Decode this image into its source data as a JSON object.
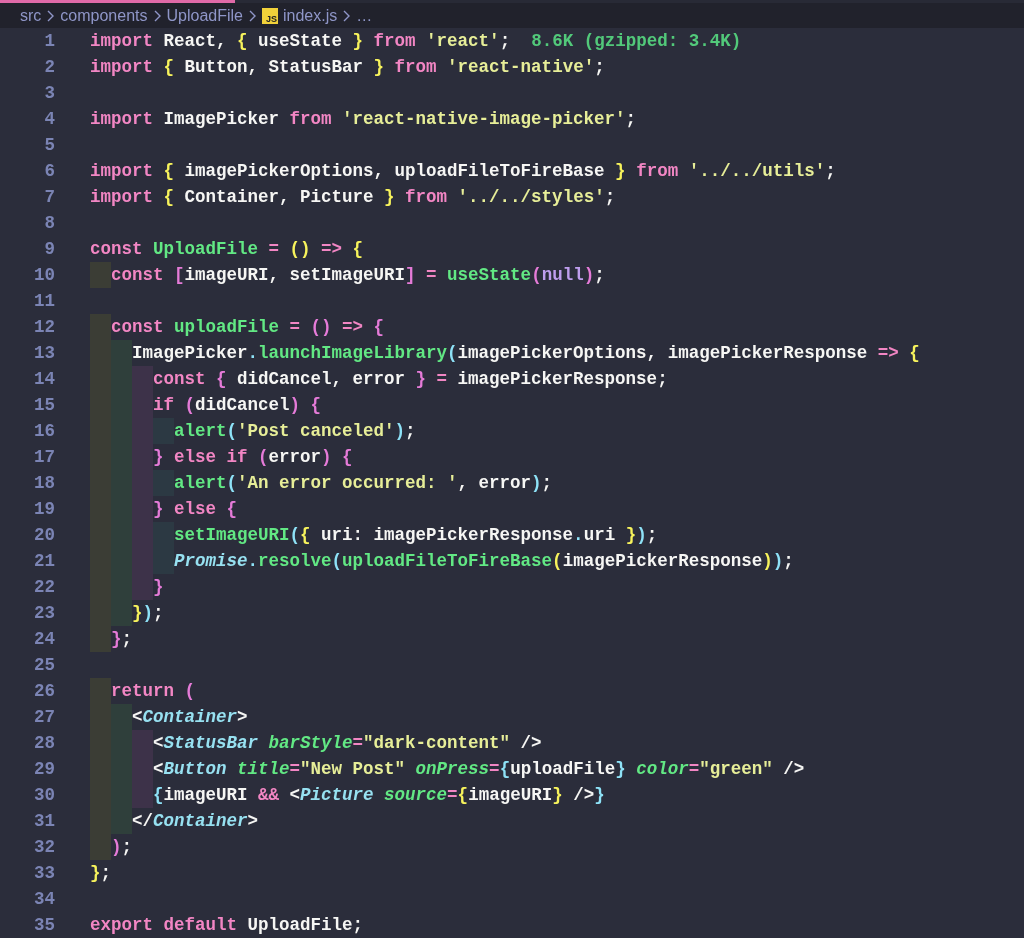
{
  "breadcrumb": [
    {
      "kind": "folder",
      "label": "src"
    },
    {
      "kind": "folder",
      "label": "components"
    },
    {
      "kind": "folder",
      "label": "UploadFile"
    },
    {
      "kind": "file",
      "label": "index.js",
      "badge": "JS"
    },
    {
      "kind": "more",
      "label": "…"
    }
  ],
  "code_lines": [
    {
      "number": "1",
      "tokens": [
        {
          "kind": "keyword",
          "text": "import"
        },
        {
          "kind": "plain",
          "text": " React, "
        },
        {
          "kind": "bracket1",
          "text": "{"
        },
        {
          "kind": "plain",
          "text": " useState "
        },
        {
          "kind": "bracket1",
          "text": "}"
        },
        {
          "kind": "keyword",
          "text": " from "
        },
        {
          "kind": "string",
          "text": "'react'"
        },
        {
          "kind": "plain",
          "text": ";"
        },
        {
          "kind": "cost",
          "text": "  8.6K (gzipped: 3.4K)"
        }
      ]
    },
    {
      "number": "2",
      "tokens": [
        {
          "kind": "keyword",
          "text": "import "
        },
        {
          "kind": "bracket1",
          "text": "{"
        },
        {
          "kind": "plain",
          "text": " Button, StatusBar "
        },
        {
          "kind": "bracket1",
          "text": "}"
        },
        {
          "kind": "keyword",
          "text": " from "
        },
        {
          "kind": "string",
          "text": "'react-native'"
        },
        {
          "kind": "plain",
          "text": ";"
        }
      ]
    },
    {
      "number": "3"
    },
    {
      "number": "4",
      "tokens": [
        {
          "kind": "keyword",
          "text": "import "
        },
        {
          "kind": "plain",
          "text": "ImagePicker "
        },
        {
          "kind": "keyword",
          "text": "from "
        },
        {
          "kind": "string",
          "text": "'react-native-image-picker'"
        },
        {
          "kind": "plain",
          "text": ";"
        }
      ]
    },
    {
      "number": "5"
    },
    {
      "number": "6",
      "tokens": [
        {
          "kind": "keyword",
          "text": "import "
        },
        {
          "kind": "bracket1",
          "text": "{"
        },
        {
          "kind": "plain",
          "text": " imagePickerOptions, uploadFileToFireBase "
        },
        {
          "kind": "bracket1",
          "text": "}"
        },
        {
          "kind": "keyword",
          "text": " from "
        },
        {
          "kind": "string",
          "text": "'../../utils'"
        },
        {
          "kind": "plain",
          "text": ";"
        }
      ]
    },
    {
      "number": "7",
      "tokens": [
        {
          "kind": "keyword",
          "text": "import "
        },
        {
          "kind": "bracket1",
          "text": "{"
        },
        {
          "kind": "plain",
          "text": " Container, Picture "
        },
        {
          "kind": "bracket1",
          "text": "}"
        },
        {
          "kind": "keyword",
          "text": " from "
        },
        {
          "kind": "string",
          "text": "'../../styles'"
        },
        {
          "kind": "plain",
          "text": ";"
        }
      ]
    },
    {
      "number": "8"
    },
    {
      "number": "9",
      "tokens": [
        {
          "kind": "keyword",
          "text": "const "
        },
        {
          "kind": "function",
          "text": "UploadFile "
        },
        {
          "kind": "operator",
          "text": "= "
        },
        {
          "kind": "bracket1",
          "text": "() "
        },
        {
          "kind": "operator",
          "text": "=> "
        },
        {
          "kind": "bracket1",
          "text": "{"
        }
      ]
    },
    {
      "number": "10",
      "tokens": [
        {
          "kind": "keyword",
          "text": "  const "
        },
        {
          "kind": "bracket2",
          "text": "["
        },
        {
          "kind": "plain",
          "text": "imageURI, setImageURI"
        },
        {
          "kind": "bracket2",
          "text": "]"
        },
        {
          "kind": "operator",
          "text": " = "
        },
        {
          "kind": "function",
          "text": "useState"
        },
        {
          "kind": "bracket2",
          "text": "("
        },
        {
          "kind": "constant",
          "text": "null"
        },
        {
          "kind": "bracket2",
          "text": ")"
        },
        {
          "kind": "plain",
          "text": ";"
        }
      ]
    },
    {
      "number": "11"
    },
    {
      "number": "12",
      "tokens": [
        {
          "kind": "keyword",
          "text": "  const "
        },
        {
          "kind": "function",
          "text": "uploadFile "
        },
        {
          "kind": "operator",
          "text": "= "
        },
        {
          "kind": "bracket2",
          "text": "() "
        },
        {
          "kind": "operator",
          "text": "=> "
        },
        {
          "kind": "bracket2",
          "text": "{"
        }
      ]
    },
    {
      "number": "13",
      "tokens": [
        {
          "kind": "plain",
          "text": "    ImagePicker"
        },
        {
          "kind": "bracket3",
          "text": "."
        },
        {
          "kind": "function",
          "text": "launchImageLibrary"
        },
        {
          "kind": "bracket3",
          "text": "("
        },
        {
          "kind": "plain",
          "text": "imagePickerOptions, imagePickerResponse "
        },
        {
          "kind": "operator",
          "text": "=> "
        },
        {
          "kind": "bracket1",
          "text": "{"
        }
      ]
    },
    {
      "number": "14",
      "tokens": [
        {
          "kind": "keyword",
          "text": "      const "
        },
        {
          "kind": "bracket2",
          "text": "{"
        },
        {
          "kind": "plain",
          "text": " didCancel, error "
        },
        {
          "kind": "bracket2",
          "text": "}"
        },
        {
          "kind": "operator",
          "text": " = "
        },
        {
          "kind": "plain",
          "text": "imagePickerResponse;"
        }
      ]
    },
    {
      "number": "15",
      "tokens": [
        {
          "kind": "keyword",
          "text": "      if "
        },
        {
          "kind": "bracket2",
          "text": "("
        },
        {
          "kind": "plain",
          "text": "didCancel"
        },
        {
          "kind": "bracket2",
          "text": ") {"
        }
      ]
    },
    {
      "number": "16",
      "tokens": [
        {
          "kind": "function",
          "text": "        alert"
        },
        {
          "kind": "bracket3",
          "text": "("
        },
        {
          "kind": "string",
          "text": "'Post canceled'"
        },
        {
          "kind": "bracket3",
          "text": ")"
        },
        {
          "kind": "plain",
          "text": ";"
        }
      ]
    },
    {
      "number": "17",
      "tokens": [
        {
          "kind": "bracket2",
          "text": "      }"
        },
        {
          "kind": "keyword",
          "text": " else if "
        },
        {
          "kind": "bracket2",
          "text": "("
        },
        {
          "kind": "plain",
          "text": "error"
        },
        {
          "kind": "bracket2",
          "text": ") {"
        }
      ]
    },
    {
      "number": "18",
      "tokens": [
        {
          "kind": "function",
          "text": "        alert"
        },
        {
          "kind": "bracket3",
          "text": "("
        },
        {
          "kind": "string",
          "text": "'An error occurred: '"
        },
        {
          "kind": "plain",
          "text": ", error"
        },
        {
          "kind": "bracket3",
          "text": ")"
        },
        {
          "kind": "plain",
          "text": ";"
        }
      ]
    },
    {
      "number": "19",
      "tokens": [
        {
          "kind": "bracket2",
          "text": "      }"
        },
        {
          "kind": "keyword",
          "text": " else "
        },
        {
          "kind": "bracket2",
          "text": "{"
        }
      ]
    },
    {
      "number": "20",
      "tokens": [
        {
          "kind": "function",
          "text": "        setImageURI"
        },
        {
          "kind": "bracket3",
          "text": "("
        },
        {
          "kind": "bracket1",
          "text": "{"
        },
        {
          "kind": "plain",
          "text": " uri: imagePickerResponse"
        },
        {
          "kind": "bracket3",
          "text": "."
        },
        {
          "kind": "plain",
          "text": "uri "
        },
        {
          "kind": "bracket1",
          "text": "}"
        },
        {
          "kind": "bracket3",
          "text": ")"
        },
        {
          "kind": "plain",
          "text": ";"
        }
      ]
    },
    {
      "number": "21",
      "tokens": [
        {
          "kind": "class",
          "text": "        Promise"
        },
        {
          "kind": "bracket3",
          "text": "."
        },
        {
          "kind": "function",
          "text": "resolve"
        },
        {
          "kind": "bracket3",
          "text": "("
        },
        {
          "kind": "function",
          "text": "uploadFileToFireBase"
        },
        {
          "kind": "bracket1",
          "text": "("
        },
        {
          "kind": "plain",
          "text": "imagePickerResponse"
        },
        {
          "kind": "bracket1",
          "text": ")"
        },
        {
          "kind": "bracket3",
          "text": ")"
        },
        {
          "kind": "plain",
          "text": ";"
        }
      ]
    },
    {
      "number": "22",
      "tokens": [
        {
          "kind": "bracket2",
          "text": "      }"
        }
      ]
    },
    {
      "number": "23",
      "tokens": [
        {
          "kind": "bracket1",
          "text": "    }"
        },
        {
          "kind": "bracket3",
          "text": ")"
        },
        {
          "kind": "plain",
          "text": ";"
        }
      ]
    },
    {
      "number": "24",
      "tokens": [
        {
          "kind": "bracket2",
          "text": "  }"
        },
        {
          "kind": "plain",
          "text": ";"
        }
      ]
    },
    {
      "number": "25"
    },
    {
      "number": "26",
      "tokens": [
        {
          "kind": "keyword",
          "text": "  return "
        },
        {
          "kind": "bracket2",
          "text": "("
        }
      ]
    },
    {
      "number": "27",
      "tokens": [
        {
          "kind": "plain",
          "text": "    <"
        },
        {
          "kind": "tag",
          "text": "Container"
        },
        {
          "kind": "plain",
          "text": ">"
        }
      ]
    },
    {
      "number": "28",
      "tokens": [
        {
          "kind": "plain",
          "text": "      <"
        },
        {
          "kind": "tag",
          "text": "StatusBar "
        },
        {
          "kind": "attribute",
          "text": "barStyle"
        },
        {
          "kind": "operator",
          "text": "="
        },
        {
          "kind": "string",
          "text": "\"dark-content\""
        },
        {
          "kind": "plain",
          "text": " />"
        }
      ]
    },
    {
      "number": "29",
      "tokens": [
        {
          "kind": "plain",
          "text": "      <"
        },
        {
          "kind": "tag",
          "text": "Button "
        },
        {
          "kind": "attribute",
          "text": "title"
        },
        {
          "kind": "operator",
          "text": "="
        },
        {
          "kind": "string",
          "text": "\"New Post\""
        },
        {
          "kind": "attribute",
          "text": " onPress"
        },
        {
          "kind": "operator",
          "text": "="
        },
        {
          "kind": "bracket3",
          "text": "{"
        },
        {
          "kind": "plain",
          "text": "uploadFile"
        },
        {
          "kind": "bracket3",
          "text": "}"
        },
        {
          "kind": "attribute",
          "text": " color"
        },
        {
          "kind": "operator",
          "text": "="
        },
        {
          "kind": "string",
          "text": "\"green\""
        },
        {
          "kind": "plain",
          "text": " />"
        }
      ]
    },
    {
      "number": "30",
      "tokens": [
        {
          "kind": "bracket3",
          "text": "      {"
        },
        {
          "kind": "plain",
          "text": "imageURI "
        },
        {
          "kind": "operator",
          "text": "&& "
        },
        {
          "kind": "plain",
          "text": "<"
        },
        {
          "kind": "tag",
          "text": "Picture "
        },
        {
          "kind": "attribute",
          "text": "source"
        },
        {
          "kind": "operator",
          "text": "="
        },
        {
          "kind": "bracket1",
          "text": "{"
        },
        {
          "kind": "plain",
          "text": "imageURI"
        },
        {
          "kind": "bracket1",
          "text": "}"
        },
        {
          "kind": "plain",
          "text": " />"
        },
        {
          "kind": "bracket3",
          "text": "}"
        }
      ]
    },
    {
      "number": "31",
      "tokens": [
        {
          "kind": "plain",
          "text": "    </"
        },
        {
          "kind": "tag",
          "text": "Container"
        },
        {
          "kind": "plain",
          "text": ">"
        }
      ]
    },
    {
      "number": "32",
      "tokens": [
        {
          "kind": "bracket2",
          "text": "  )"
        },
        {
          "kind": "plain",
          "text": ";"
        }
      ]
    },
    {
      "number": "33",
      "tokens": [
        {
          "kind": "bracket1",
          "text": "}"
        },
        {
          "kind": "plain",
          "text": ";"
        }
      ]
    },
    {
      "number": "34"
    },
    {
      "number": "35",
      "tokens": [
        {
          "kind": "keyword",
          "text": "export default "
        },
        {
          "kind": "plain",
          "text": "UploadFile;"
        }
      ]
    }
  ]
}
